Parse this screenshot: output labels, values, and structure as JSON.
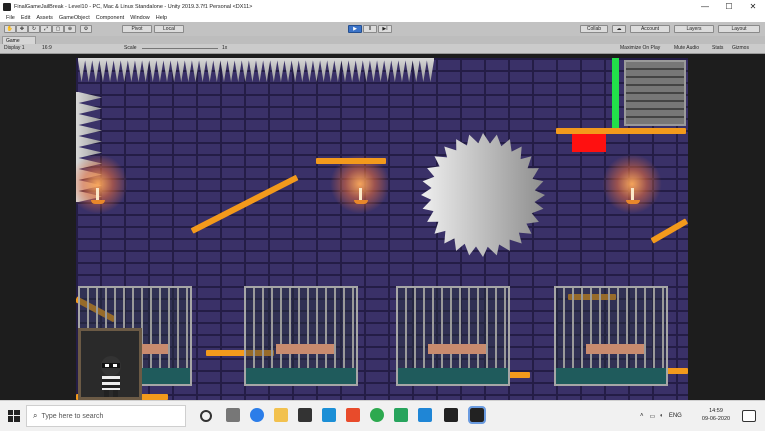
{
  "window": {
    "title": "FinalGameJailBreak - Level10 - PC, Mac & Linux Standalone - Unity 2019.3.7f1 Personal <DX11>",
    "minimize": "—",
    "maximize": "☐",
    "close": "✕"
  },
  "menu": [
    "File",
    "Edit",
    "Assets",
    "GameObject",
    "Component",
    "Window",
    "Help"
  ],
  "toolbar": {
    "pivot": "Pivot",
    "local": "Local",
    "play": "▶",
    "pause": "II",
    "step": "▶I",
    "collab": "Collab",
    "account": "Account",
    "layers": "Layers",
    "layout": "Layout"
  },
  "game": {
    "tab": "Game",
    "display": "Display 1",
    "aspect": "16:9",
    "scale_label": "Scale",
    "scale_value": "1x",
    "maximize_on_play": "Maximize On Play",
    "mute_audio": "Mute Audio",
    "stats": "Stats",
    "gizmos": "Gizmos"
  },
  "taskbar": {
    "search_placeholder": "Type here to search",
    "language": "ENG",
    "time": "14:59",
    "date": "09-06-2020"
  },
  "colors": {
    "platform": "#f39a1c",
    "brick": "#3a3168",
    "trap_red": "#ff1010",
    "exit_green": "#22e04a"
  }
}
